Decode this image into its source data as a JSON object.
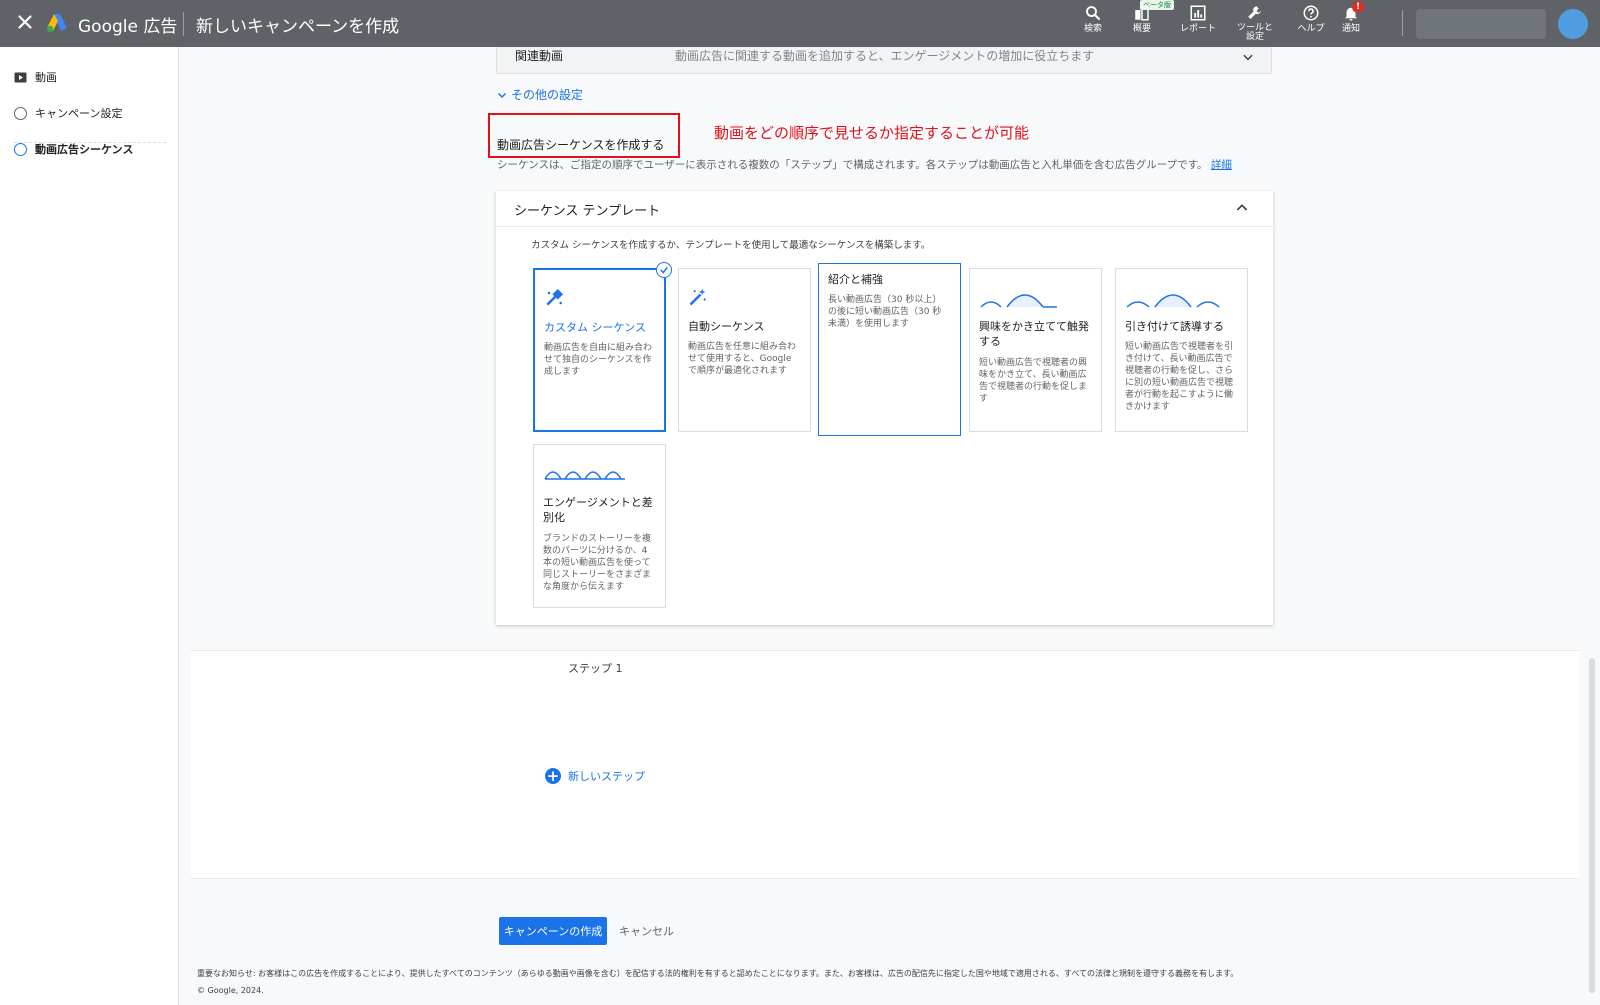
{
  "topbar": {
    "brand": "Google 広告",
    "title": "新しいキャンペーンを作成",
    "icons": [
      {
        "name": "search-icon",
        "label": "検索"
      },
      {
        "name": "overview-icon",
        "label": "概要",
        "badge": "ベータ版"
      },
      {
        "name": "report-icon",
        "label": "レポート"
      },
      {
        "name": "tools-icon",
        "label": "ツールと\n設定"
      },
      {
        "name": "help-icon",
        "label": "ヘルプ"
      },
      {
        "name": "bell-icon",
        "label": "通知",
        "badge": "!"
      }
    ]
  },
  "sidebar": {
    "items": [
      {
        "label": "動画",
        "icon": "video-icon"
      },
      {
        "label": "キャンペーン設定",
        "icon": "circle-icon"
      },
      {
        "label": "動画広告シーケンス",
        "icon": "circle-icon",
        "active": true
      }
    ]
  },
  "related": {
    "label": "関連動画",
    "description": "動画広告に関連する動画を追加すると、エンゲージメントの増加に役立ちます"
  },
  "other_settings": "その他の設定",
  "sequence": {
    "title": "動画広告シーケンスを作成する",
    "annotation": "動画をどの順序で見せるか指定することが可能",
    "description": "シーケンスは、ご指定の順序でユーザーに表示される複数の「ステップ」で構成されます。各ステップは動画広告と入札単価を含む広告グループです。",
    "detail_link": "詳細"
  },
  "template": {
    "title": "シーケンス テンプレート",
    "subtitle": "カスタム シーケンスを作成するか、テンプレートを使用して最適なシーケンスを構築します。",
    "cards": [
      {
        "name": "カスタム シーケンス",
        "desc": "動画広告を自由に組み合わせて独自のシーケンスを作成します",
        "icon": "custom-sequence-icon",
        "selected": true
      },
      {
        "name": "自動シーケンス",
        "desc": "動画広告を任意に組み合わせて使用すると、Google で順序が最適化されます",
        "icon": "magic-wand-icon"
      },
      {
        "name": "紹介と補強",
        "desc": "長い動画広告（30 秒以上）の後に短い動画広告（30 秒未満）を使用します",
        "icon": "none"
      },
      {
        "name": "興味をかき立てて触発する",
        "desc": "短い動画広告で視聴者の興味をかき立て、長い動画広告で視聴者の行動を促します",
        "icon": "wave-small-big-icon"
      },
      {
        "name": "引き付けて誘導する",
        "desc": "短い動画広告で視聴者を引き付けて、長い動画広告で視聴者の行動を促し、さらに別の短い動画広告で視聴者が行動を起こすように働きかけます",
        "icon": "wave-small-big-small-icon"
      },
      {
        "name": "エンゲージメントと差別化",
        "desc": "ブランドのストーリーを複数のパーツに分けるか、4 本の短い動画広告を使って同じストーリーをさまざまな角度から伝えます",
        "icon": "wave-four-icon"
      }
    ]
  },
  "steps": {
    "step_label": "ステップ 1",
    "new_step": "新しいステップ"
  },
  "actions": {
    "create": "キャンペーンの作成",
    "cancel": "キャンセル"
  },
  "footer": {
    "notice": "重要なお知らせ: お客様はこの広告を作成することにより、提供したすべてのコンテンツ（あらゆる動画や画像を含む）を配信する法的権利を有すると認めたことになります。また、お客様は、広告の配信先に指定した国や地域で適用される、すべての法律と規制を遵守する義務を有します。",
    "copyright": "© Google, 2024."
  },
  "colors": {
    "accent": "#1a73e8",
    "topbar": "#5f6368",
    "annotation": "#e3111c"
  }
}
